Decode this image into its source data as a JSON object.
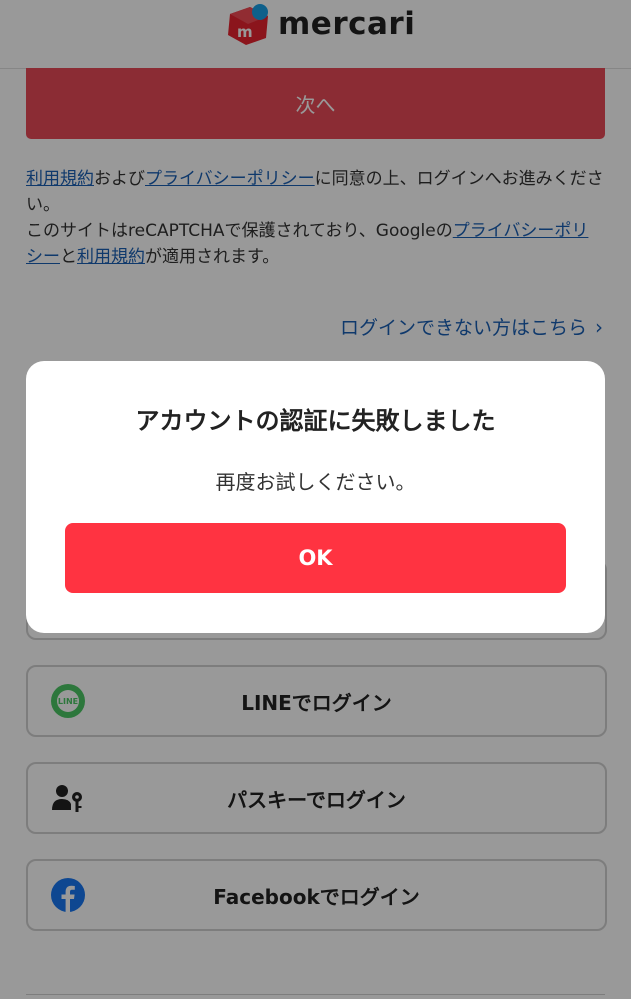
{
  "header": {
    "logo_text": "mercari"
  },
  "form": {
    "next_label": "次へ"
  },
  "terms": {
    "line1_link1": "利用規約",
    "line1_text1": "および",
    "line1_link2": "プライバシーポリシー",
    "line1_text2": "に同意の上、ログインへお進みください。",
    "line2_text1": "このサイトはreCAPTCHAで保護されており、Googleの",
    "line2_link1": "プライバシーポリシー",
    "line2_text2": "と",
    "line2_link2": "利用規約",
    "line2_text3": "が適用されます。"
  },
  "cant_login": {
    "label": "ログインできない方はこちら",
    "chevron": "›"
  },
  "social": [
    {
      "label": "LINEでログイン",
      "icon": "line-icon"
    },
    {
      "label": "パスキーでログイン",
      "icon": "passkey-icon"
    },
    {
      "label": "Facebookでログイン",
      "icon": "facebook-icon"
    }
  ],
  "dialog": {
    "title": "アカウントの認証に失敗しました",
    "message": "再度お試しください。",
    "ok_label": "OK"
  },
  "colors": {
    "brand_red": "#ff3341",
    "link_blue": "#1a5fb4",
    "line_green": "#4cc764",
    "facebook_blue": "#1877f2"
  }
}
